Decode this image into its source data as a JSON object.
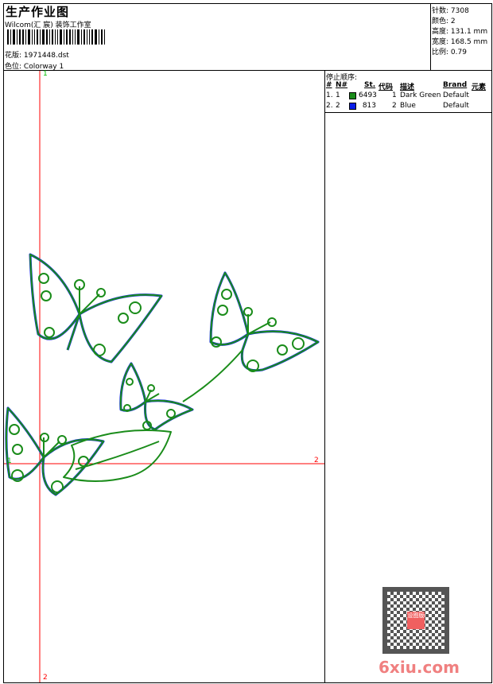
{
  "header": {
    "title": "生产作业图",
    "company": "Wilcom(汇 宸) 装饰工作室",
    "design_label": "花版:",
    "design_value": "1971448.dst",
    "colorway_label": "色位:",
    "colorway_value": "Colorway 1"
  },
  "stats": {
    "stitches_label": "针数:",
    "stitches": "7308",
    "colors_label": "颜色:",
    "colors": "2",
    "height_label": "高度:",
    "height": "131.1 mm",
    "width_label": "宽度:",
    "width": "168.5 mm",
    "scale_label": "比例:",
    "scale": "0.79"
  },
  "color_table": {
    "title": "停止顺序:",
    "headers": {
      "idx": "#",
      "no": "N#",
      "st": "St.",
      "code": "代码",
      "desc": "描述",
      "brand": "Brand",
      "element": "元素"
    },
    "rows": [
      {
        "idx": "1.",
        "no": "1",
        "color": "#1a8c1a",
        "st": "6493",
        "code": "1",
        "desc": "Dark Green",
        "brand": "Default"
      },
      {
        "idx": "2.",
        "no": "2",
        "color": "#0a1ee8",
        "st": "813",
        "code": "2",
        "desc": "Blue",
        "brand": "Default"
      }
    ]
  },
  "markers": {
    "top": "1",
    "left": "1",
    "right": "2",
    "bottom": "2"
  },
  "watermark": {
    "text": "6xiu.com",
    "seal": "设图版"
  },
  "colors": {
    "axis": "#ff0000",
    "marker_start": "#00c000",
    "thread1": "#1a8c1a",
    "thread2": "#0a1ee8"
  }
}
